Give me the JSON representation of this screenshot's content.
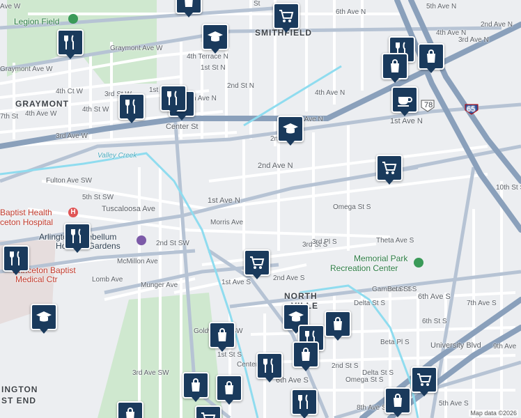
{
  "map": {
    "attribution": "Map data ©2026",
    "colors": {
      "background": "#eceef1",
      "park": "#cfe8cf",
      "major_road": "#8aa0bb",
      "street": "#ffffff",
      "water": "#8fdcef",
      "pin": "#1a3a5c"
    },
    "areas": {
      "graymont": "GRAYMONT",
      "smithfield": "SMITHFIELD",
      "north": "NORTH",
      "ville": "VILLE",
      "ington": "INGTON",
      "st_end": "ST END"
    },
    "pois": {
      "legion_field": "Legion Field",
      "baptist_health_1": "Baptist Health",
      "baptist_health_2": "ceton Hospital",
      "arlington_1": "Arlington-Antebellum",
      "arlington_2": "Home & Gardens",
      "princeton_1": "Princeton Baptist",
      "princeton_2": "Medical Ctr",
      "memorial_1": "Memorial Park",
      "memorial_2": "Recreation Center"
    },
    "water": {
      "valley_creek": "Valley Creek"
    },
    "highways": {
      "us78": "78",
      "i65": "65"
    },
    "streets": {
      "s_6th_ave_top_left": "Ave W",
      "s_6th_ave_n_top": "6th Ave N",
      "s_5th_ave_n": "5th Ave N",
      "s_4th_ave_n_ne": "4th Ave N",
      "s_3rd_ave_n_ne": "3rd Ave N",
      "s_2nd_ave_n_ne": "2nd Ave N",
      "s_graymont_ave_w": "Graymont Ave W",
      "s_graymont_ave_w2": "Graymont Ave W",
      "s_4th_terrace_n": "4th Terrace N",
      "s_4th_ct_w": "4th Ct W",
      "s_4th_ave_w": "4th Ave W",
      "s_3rd_ave_w": "3rd Ave W",
      "s_3rd_ave_n": "3rd Ave N",
      "s_4th_ave_n": "4th Ave N",
      "s_4th_ave_n_center": "h Ave N",
      "s_2nd_ave_n": "2nd Ave N",
      "s_1st_ave_n": "1st Ave N",
      "s_1st_ave_n_e": "1st Ave N",
      "s_tuscaloosa": "Tuscaloosa Ave",
      "s_morris": "Morris Ave",
      "s_fulton": "Fulton Ave SW",
      "s_5th_st_sw": "5th St SW",
      "s_2nd_st_sw": "2nd St SW",
      "s_mcmillon": "McMillon Ave",
      "s_lomb": "Lomb Ave",
      "s_munger": "Munger Ave",
      "s_center_st": "Center St",
      "s_center_st_s": "Center St S",
      "s_1st_st_n": "1st St N",
      "s_1st_st_w": "1st St",
      "s_2nd_st_n": "2nd St N",
      "s_3rd_st_w": "3rd St W",
      "s_4th_st_w": "4th St W",
      "s_7th_st_w": "7th St",
      "s_3rd_st_s": "3rd St S",
      "s_3rd_pl_s": "3rd Pl S",
      "s_omega_st_s": "Omega St S",
      "s_omega_st_s2": "Omega St S",
      "s_theta": "Theta Ave S",
      "s_1st_ave_s": "1st Ave S",
      "s_2nd_ave_s": "2nd Ave S",
      "s_delta": "Delta St S",
      "s_delta2": "Delta St S",
      "s_gamma": "Gamma St S",
      "s_beta": "Beta St S",
      "s_beta_pl": "Beta Pl S",
      "s_6th_ave_s": "6th Ave S",
      "s_6th_ave_s2": "6th Ave S",
      "s_6th_st_s": "6th St S",
      "s_7th_ave_s": "7th Ave S",
      "s_8th_ave_s": "8th Ave S",
      "s_9th_ave": "9th Ave",
      "s_university": "University Blvd",
      "s_10th_st": "10th St S",
      "s_goldwire": "Goldwire St SW",
      "s_1st_st_s": "1st St S",
      "s_2nd_st_s": "2nd St S",
      "s_3rd_ave_sw": "3rd Ave SW",
      "s_2nd": "2n",
      "s_st": "St",
      "s_5th_ave_s": "5th Ave S"
    },
    "pins": [
      "shopping-bag",
      "shopping-cart",
      "school",
      "restaurant",
      "restaurant",
      "shopping-bag",
      "shopping-bag",
      "shopping-bag",
      "school",
      "coffee",
      "restaurant",
      "restaurant",
      "shopping-cart",
      "restaurant",
      "restaurant",
      "school",
      "shopping-cart",
      "school",
      "restaurant",
      "shopping-bag",
      "shopping-bag",
      "restaurant",
      "shopping-bag",
      "shopping-bag",
      "shopping-bag",
      "restaurant",
      "shopping-cart",
      "shopping-bag",
      "shopping-bag",
      "shopping-cart"
    ]
  }
}
